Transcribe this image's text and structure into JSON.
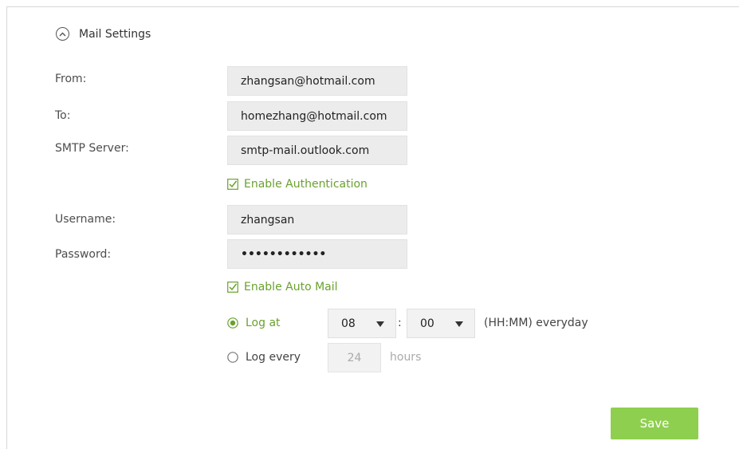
{
  "section": {
    "title": "Mail Settings",
    "icon": "chevron-up-circle-icon"
  },
  "fields": {
    "from_label": "From:",
    "from_value": "zhangsan@hotmail.com",
    "to_label": "To:",
    "to_value": "homezhang@hotmail.com",
    "smtp_label": "SMTP Server:",
    "smtp_value": "smtp-mail.outlook.com",
    "enable_auth_label": "Enable Authentication",
    "enable_auth_checked": true,
    "username_label": "Username:",
    "username_value": "zhangsan",
    "password_label": "Password:",
    "password_value": "••••••••••••",
    "enable_auto_mail_label": "Enable Auto Mail",
    "enable_auto_mail_checked": true
  },
  "schedule": {
    "log_at_label": "Log at",
    "log_at_selected": true,
    "hour_value": "08",
    "minute_value": "00",
    "separator": ":",
    "time_hint": "(HH:MM) everyday",
    "log_every_label": "Log every",
    "log_every_selected": false,
    "interval_value": "24",
    "interval_unit": "hours"
  },
  "actions": {
    "save_label": "Save"
  },
  "colors": {
    "accent": "#6aa12e",
    "button": "#8fcf4f",
    "field_bg": "#ececec"
  }
}
